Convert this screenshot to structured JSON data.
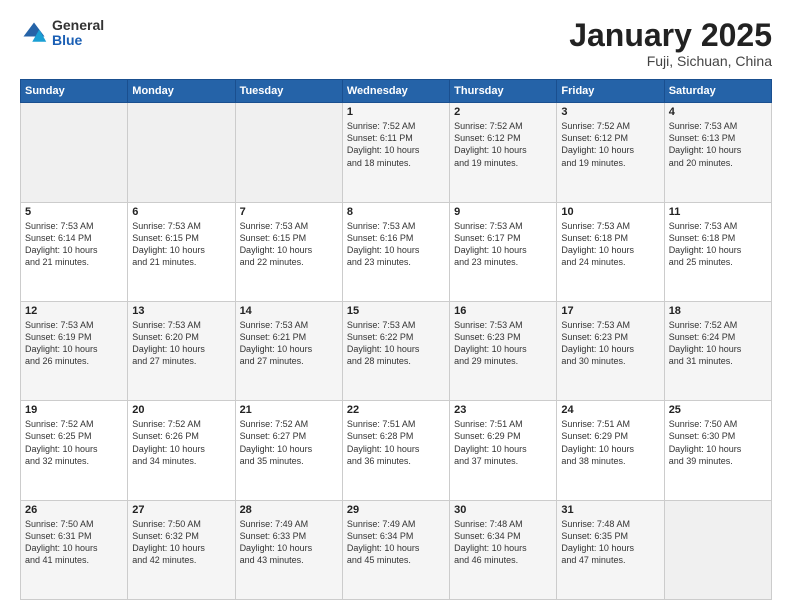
{
  "header": {
    "logo": {
      "general": "General",
      "blue": "Blue"
    },
    "title": "January 2025",
    "subtitle": "Fuji, Sichuan, China"
  },
  "weekdays": [
    "Sunday",
    "Monday",
    "Tuesday",
    "Wednesday",
    "Thursday",
    "Friday",
    "Saturday"
  ],
  "weeks": [
    [
      {
        "num": "",
        "info": ""
      },
      {
        "num": "",
        "info": ""
      },
      {
        "num": "",
        "info": ""
      },
      {
        "num": "1",
        "info": "Sunrise: 7:52 AM\nSunset: 6:11 PM\nDaylight: 10 hours\nand 18 minutes."
      },
      {
        "num": "2",
        "info": "Sunrise: 7:52 AM\nSunset: 6:12 PM\nDaylight: 10 hours\nand 19 minutes."
      },
      {
        "num": "3",
        "info": "Sunrise: 7:52 AM\nSunset: 6:12 PM\nDaylight: 10 hours\nand 19 minutes."
      },
      {
        "num": "4",
        "info": "Sunrise: 7:53 AM\nSunset: 6:13 PM\nDaylight: 10 hours\nand 20 minutes."
      }
    ],
    [
      {
        "num": "5",
        "info": "Sunrise: 7:53 AM\nSunset: 6:14 PM\nDaylight: 10 hours\nand 21 minutes."
      },
      {
        "num": "6",
        "info": "Sunrise: 7:53 AM\nSunset: 6:15 PM\nDaylight: 10 hours\nand 21 minutes."
      },
      {
        "num": "7",
        "info": "Sunrise: 7:53 AM\nSunset: 6:15 PM\nDaylight: 10 hours\nand 22 minutes."
      },
      {
        "num": "8",
        "info": "Sunrise: 7:53 AM\nSunset: 6:16 PM\nDaylight: 10 hours\nand 23 minutes."
      },
      {
        "num": "9",
        "info": "Sunrise: 7:53 AM\nSunset: 6:17 PM\nDaylight: 10 hours\nand 23 minutes."
      },
      {
        "num": "10",
        "info": "Sunrise: 7:53 AM\nSunset: 6:18 PM\nDaylight: 10 hours\nand 24 minutes."
      },
      {
        "num": "11",
        "info": "Sunrise: 7:53 AM\nSunset: 6:18 PM\nDaylight: 10 hours\nand 25 minutes."
      }
    ],
    [
      {
        "num": "12",
        "info": "Sunrise: 7:53 AM\nSunset: 6:19 PM\nDaylight: 10 hours\nand 26 minutes."
      },
      {
        "num": "13",
        "info": "Sunrise: 7:53 AM\nSunset: 6:20 PM\nDaylight: 10 hours\nand 27 minutes."
      },
      {
        "num": "14",
        "info": "Sunrise: 7:53 AM\nSunset: 6:21 PM\nDaylight: 10 hours\nand 27 minutes."
      },
      {
        "num": "15",
        "info": "Sunrise: 7:53 AM\nSunset: 6:22 PM\nDaylight: 10 hours\nand 28 minutes."
      },
      {
        "num": "16",
        "info": "Sunrise: 7:53 AM\nSunset: 6:23 PM\nDaylight: 10 hours\nand 29 minutes."
      },
      {
        "num": "17",
        "info": "Sunrise: 7:53 AM\nSunset: 6:23 PM\nDaylight: 10 hours\nand 30 minutes."
      },
      {
        "num": "18",
        "info": "Sunrise: 7:52 AM\nSunset: 6:24 PM\nDaylight: 10 hours\nand 31 minutes."
      }
    ],
    [
      {
        "num": "19",
        "info": "Sunrise: 7:52 AM\nSunset: 6:25 PM\nDaylight: 10 hours\nand 32 minutes."
      },
      {
        "num": "20",
        "info": "Sunrise: 7:52 AM\nSunset: 6:26 PM\nDaylight: 10 hours\nand 34 minutes."
      },
      {
        "num": "21",
        "info": "Sunrise: 7:52 AM\nSunset: 6:27 PM\nDaylight: 10 hours\nand 35 minutes."
      },
      {
        "num": "22",
        "info": "Sunrise: 7:51 AM\nSunset: 6:28 PM\nDaylight: 10 hours\nand 36 minutes."
      },
      {
        "num": "23",
        "info": "Sunrise: 7:51 AM\nSunset: 6:29 PM\nDaylight: 10 hours\nand 37 minutes."
      },
      {
        "num": "24",
        "info": "Sunrise: 7:51 AM\nSunset: 6:29 PM\nDaylight: 10 hours\nand 38 minutes."
      },
      {
        "num": "25",
        "info": "Sunrise: 7:50 AM\nSunset: 6:30 PM\nDaylight: 10 hours\nand 39 minutes."
      }
    ],
    [
      {
        "num": "26",
        "info": "Sunrise: 7:50 AM\nSunset: 6:31 PM\nDaylight: 10 hours\nand 41 minutes."
      },
      {
        "num": "27",
        "info": "Sunrise: 7:50 AM\nSunset: 6:32 PM\nDaylight: 10 hours\nand 42 minutes."
      },
      {
        "num": "28",
        "info": "Sunrise: 7:49 AM\nSunset: 6:33 PM\nDaylight: 10 hours\nand 43 minutes."
      },
      {
        "num": "29",
        "info": "Sunrise: 7:49 AM\nSunset: 6:34 PM\nDaylight: 10 hours\nand 45 minutes."
      },
      {
        "num": "30",
        "info": "Sunrise: 7:48 AM\nSunset: 6:34 PM\nDaylight: 10 hours\nand 46 minutes."
      },
      {
        "num": "31",
        "info": "Sunrise: 7:48 AM\nSunset: 6:35 PM\nDaylight: 10 hours\nand 47 minutes."
      },
      {
        "num": "",
        "info": ""
      }
    ]
  ]
}
